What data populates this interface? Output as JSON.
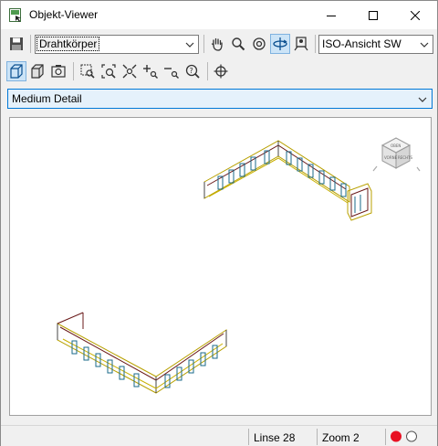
{
  "window": {
    "title": "Objekt-Viewer"
  },
  "toolbar": {
    "visual_style": "Drahtkörper",
    "view": "ISO-Ansicht SW",
    "icons": [
      "save-icon",
      "pan-hand-icon",
      "zoom-icon",
      "orbit-icon",
      "free-orbit-icon",
      "camera-icon",
      "wireframe-box-icon",
      "shaded-box-icon",
      "camera-settings-icon",
      "zoom-window-icon",
      "zoom-extents-icon",
      "zoom-all-icon",
      "zoom-in-icon",
      "zoom-out-icon",
      "zoom-realtime-icon",
      "locate-crosshair-icon"
    ]
  },
  "detail_level": {
    "value": "Medium Detail"
  },
  "viewcube": {
    "top_label": "OBEN",
    "face_label": "VORNE",
    "side_label": "RECHTS"
  },
  "status": {
    "lines": "Linse 28",
    "zoom": "Zoom 2",
    "colors": {
      "red": "#e81123",
      "white": "#ffffff"
    }
  }
}
